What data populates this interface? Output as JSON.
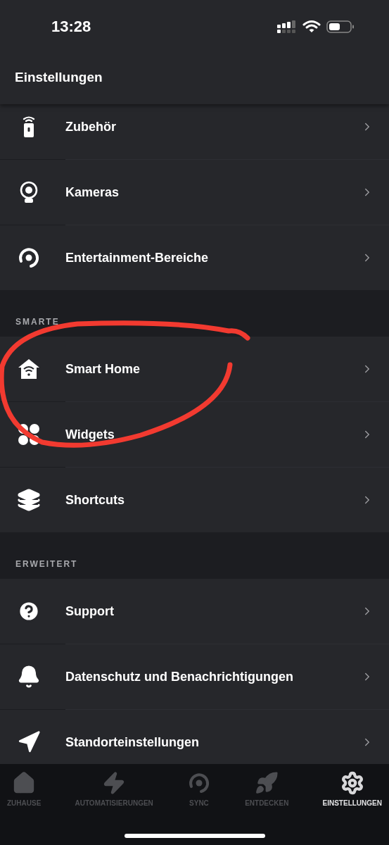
{
  "status_bar": {
    "time": "13:28"
  },
  "header": {
    "title": "Einstellungen"
  },
  "sections": [
    {
      "items": [
        {
          "label": "Zubehör"
        },
        {
          "label": "Kameras"
        },
        {
          "label": "Entertainment-Bereiche"
        }
      ]
    },
    {
      "heading": "SMARTE",
      "items": [
        {
          "label": "Smart Home"
        },
        {
          "label": "Widgets"
        },
        {
          "label": "Shortcuts"
        }
      ]
    },
    {
      "heading": "ERWEITERT",
      "items": [
        {
          "label": "Support"
        },
        {
          "label": "Datenschutz und Benachrichtigungen"
        },
        {
          "label": "Standorteinstellungen"
        }
      ]
    }
  ],
  "tab_bar": [
    {
      "label": "ZUHAUSE",
      "selected": false
    },
    {
      "label": "AUTOMATISIERUNGEN",
      "selected": false
    },
    {
      "label": "SYNC",
      "selected": false
    },
    {
      "label": "ENTDECKEN",
      "selected": false
    },
    {
      "label": "EINSTELLUNGEN",
      "selected": true
    }
  ]
}
